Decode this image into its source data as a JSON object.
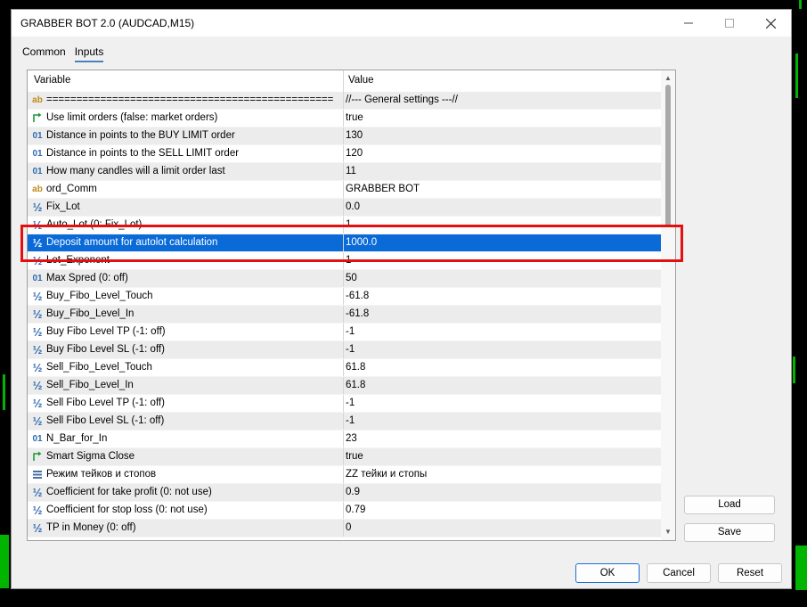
{
  "window": {
    "title": "GRABBER BOT 2.0 (AUDCAD,M15)",
    "minimize_icon": "minimize-icon",
    "maximize_icon": "maximize-icon",
    "close_icon": "close-icon"
  },
  "tabs": [
    {
      "label": "Common",
      "active": false
    },
    {
      "label": "Inputs",
      "active": true
    }
  ],
  "table": {
    "headers": {
      "variable": "Variable",
      "value": "Value"
    },
    "selected_index": 8,
    "rows": [
      {
        "icon": "ab",
        "type": "string",
        "variable": "================================================",
        "value": "//--- General settings ---//"
      },
      {
        "icon": "bool-arrow",
        "type": "bool",
        "variable": "Use limit orders (false: market orders)",
        "value": "true"
      },
      {
        "icon": "01",
        "type": "int",
        "variable": "Distance in points to the BUY LIMIT order",
        "value": "130"
      },
      {
        "icon": "01",
        "type": "int",
        "variable": "Distance in points to the SELL LIMIT order",
        "value": "120"
      },
      {
        "icon": "01",
        "type": "int",
        "variable": "How many candles will a limit order last",
        "value": "11"
      },
      {
        "icon": "ab",
        "type": "string",
        "variable": "ord_Comm",
        "value": "GRABBER BOT"
      },
      {
        "icon": "½",
        "type": "double",
        "variable": "Fix_Lot",
        "value": "0.0"
      },
      {
        "icon": "½",
        "type": "double",
        "variable": "Auto_Lot (0: Fix_Lot)",
        "value": "1"
      },
      {
        "icon": "½",
        "type": "double",
        "variable": "Deposit amount for autolot calculation",
        "value": "1000.0"
      },
      {
        "icon": "½",
        "type": "double",
        "variable": "Lot_Exponent",
        "value": "1"
      },
      {
        "icon": "01",
        "type": "int",
        "variable": "Max Spred (0: off)",
        "value": "50"
      },
      {
        "icon": "½",
        "type": "double",
        "variable": "Buy_Fibo_Level_Touch",
        "value": "-61.8"
      },
      {
        "icon": "½",
        "type": "double",
        "variable": "Buy_Fibo_Level_In",
        "value": "-61.8"
      },
      {
        "icon": "½",
        "type": "double",
        "variable": "Buy Fibo Level TP (-1: off)",
        "value": "-1"
      },
      {
        "icon": "½",
        "type": "double",
        "variable": "Buy Fibo Level SL (-1: off)",
        "value": "-1"
      },
      {
        "icon": "½",
        "type": "double",
        "variable": "Sell_Fibo_Level_Touch",
        "value": "61.8"
      },
      {
        "icon": "½",
        "type": "double",
        "variable": "Sell_Fibo_Level_In",
        "value": "61.8"
      },
      {
        "icon": "½",
        "type": "double",
        "variable": "Sell Fibo Level TP (-1: off)",
        "value": "-1"
      },
      {
        "icon": "½",
        "type": "double",
        "variable": "Sell Fibo Level SL (-1: off)",
        "value": "-1"
      },
      {
        "icon": "01",
        "type": "int",
        "variable": "N_Bar_for_In",
        "value": "23"
      },
      {
        "icon": "bool-arrow",
        "type": "bool",
        "variable": "Smart Sigma Close",
        "value": "true"
      },
      {
        "icon": "enum",
        "type": "enum",
        "variable": "Режим тейков и стопов",
        "value": "ZZ тейки и стопы"
      },
      {
        "icon": "½",
        "type": "double",
        "variable": "Coefficient for take profit (0: not use)",
        "value": "0.9"
      },
      {
        "icon": "½",
        "type": "double",
        "variable": "Coefficient for stop loss (0: not use)",
        "value": "0.79"
      },
      {
        "icon": "½",
        "type": "double",
        "variable": "TP in Money (0: off)",
        "value": "0"
      }
    ]
  },
  "buttons": {
    "load": "Load",
    "save": "Save",
    "ok": "OK",
    "cancel": "Cancel",
    "reset": "Reset"
  },
  "colors": {
    "selection": "#0a6ad8",
    "highlight_box": "#e41010",
    "chart_background": "#000000",
    "chart_green": "#00b400"
  }
}
